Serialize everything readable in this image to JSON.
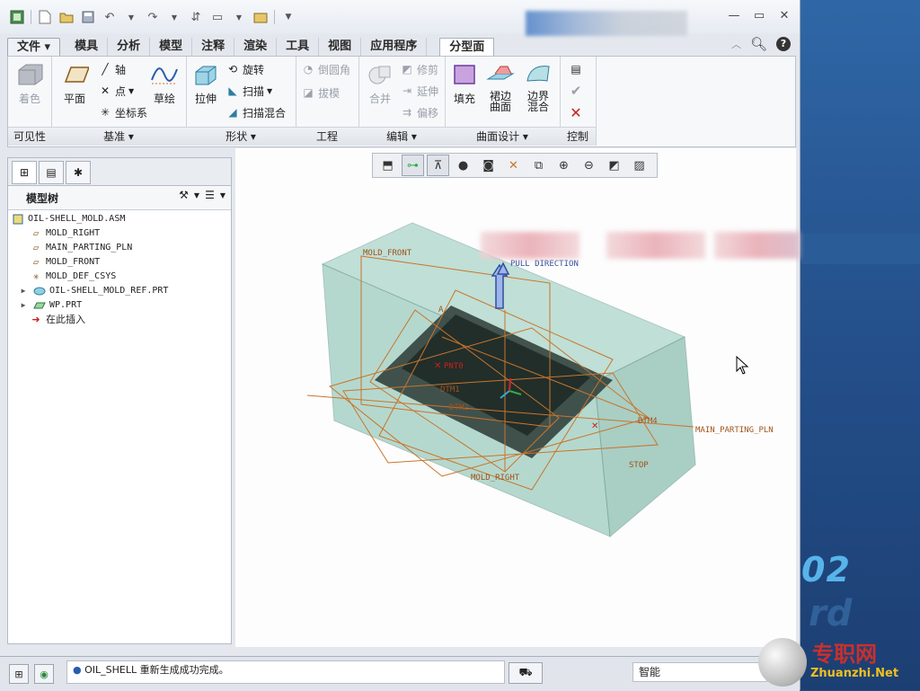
{
  "window": {
    "quick_access": [
      "new-icon",
      "open-icon",
      "save-icon",
      "undo-icon",
      "redo-icon",
      "regenerate-icon",
      "window-icon",
      "close-window-icon",
      "customize-icon"
    ],
    "controls": [
      "minimize",
      "maximize",
      "close"
    ]
  },
  "tabs": [
    "文件",
    "模具",
    "分析",
    "模型",
    "注释",
    "渲染",
    "工具",
    "视图",
    "应用程序",
    "分型面"
  ],
  "active_tab": "分型面",
  "ribbon": {
    "visibility": {
      "shade": "着色",
      "label": "可见性"
    },
    "datum": {
      "plane": "平面",
      "axis": "轴",
      "point": "点",
      "csys": "坐标系",
      "sketch": "草绘",
      "label": "基准"
    },
    "shapes": {
      "extrude": "拉伸",
      "revolve": "旋转",
      "sweep": "扫描",
      "swept_blend": "扫描混合",
      "label": "形状"
    },
    "engineering": {
      "round": "倒圆角",
      "draft": "拔模",
      "label": "工程"
    },
    "editing": {
      "merge": "合并",
      "trim": "修剪",
      "extend": "延伸",
      "offset": "偏移",
      "label": "编辑"
    },
    "surface_design": {
      "fill": "填充",
      "skirt": "裙边\n曲面",
      "boundary": "边界\n混合",
      "label": "曲面设计"
    },
    "control": {
      "label": "控制"
    }
  },
  "model_tree": {
    "title": "模型树",
    "items": [
      {
        "label": "OIL-SHELL_MOLD.ASM",
        "icon": "assembly-icon"
      },
      {
        "label": "MOLD_RIGHT",
        "icon": "datum-plane-icon"
      },
      {
        "label": "MAIN_PARTING_PLN",
        "icon": "datum-plane-icon"
      },
      {
        "label": "MOLD_FRONT",
        "icon": "datum-plane-icon"
      },
      {
        "label": "MOLD_DEF_CSYS",
        "icon": "csys-icon"
      },
      {
        "label": "OIL-SHELL_MOLD_REF.PRT",
        "icon": "part-icon"
      },
      {
        "label": "WP.PRT",
        "icon": "workpiece-icon"
      },
      {
        "label": "在此插入",
        "icon": "insert-arrow-icon"
      }
    ]
  },
  "viewport_labels": {
    "mold_front": "MOLD_FRONT",
    "pull_direction": "PULL DIRECTION",
    "main_parting_pln": "MAIN_PARTING_PLN",
    "mold_right": "MOLD_RIGHT",
    "pnt0": "PNT0",
    "dtm1": "DTM1",
    "dtm2": "DTM2",
    "stop": "STOP",
    "dtm4": "DTM4",
    "a": "A"
  },
  "status": {
    "message": "OIL_SHELL 重新生成成功完成。",
    "filter": "智能"
  },
  "watermark": {
    "cn": "专职网",
    "en": "Zhuanzhi.Net",
    "bignum": "02"
  },
  "colors": {
    "mold_block": "#8fc7b8",
    "datum_plane": "#c8752a",
    "accent_blue": "#2d62b2"
  }
}
